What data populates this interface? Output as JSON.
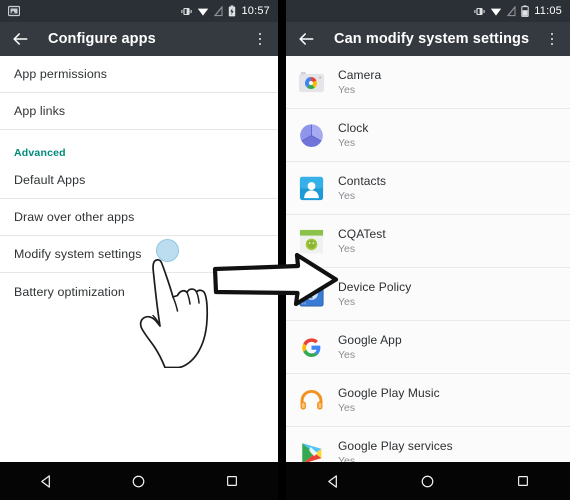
{
  "left_phone": {
    "status_bar": {
      "time": "10:57",
      "icons": [
        "screenshot-icon",
        "vibrate-icon",
        "wifi-icon",
        "signal-off-icon",
        "battery-charging-icon"
      ]
    },
    "app_bar": {
      "back_label": "back-arrow",
      "title": "Configure apps",
      "overflow_label": "more-options"
    },
    "items": [
      {
        "label": "App permissions",
        "type": "row"
      },
      {
        "label": "App links",
        "type": "row"
      },
      {
        "label": "Advanced",
        "type": "section"
      },
      {
        "label": "Default Apps",
        "type": "row"
      },
      {
        "label": "Draw over other apps",
        "type": "row"
      },
      {
        "label": "Modify system settings",
        "type": "row"
      },
      {
        "label": "Battery optimization",
        "type": "row"
      }
    ],
    "nav_bar": {
      "back": "back-triangle",
      "home": "home-circle",
      "recents": "recents-square"
    }
  },
  "right_phone": {
    "status_bar": {
      "time": "11:05",
      "icons": [
        "vibrate-icon",
        "wifi-icon",
        "signal-off-icon",
        "battery-icon"
      ]
    },
    "app_bar": {
      "back_label": "back-arrow",
      "title": "Can modify system settings",
      "overflow_label": "more-options"
    },
    "apps": [
      {
        "name": "Camera",
        "status": "Yes",
        "icon": "camera-app-icon"
      },
      {
        "name": "Clock",
        "status": "Yes",
        "icon": "clock-app-icon"
      },
      {
        "name": "Contacts",
        "status": "Yes",
        "icon": "contacts-app-icon"
      },
      {
        "name": "CQATest",
        "status": "Yes",
        "icon": "cqatest-app-icon"
      },
      {
        "name": "Device Policy",
        "status": "Yes",
        "icon": "device-policy-app-icon"
      },
      {
        "name": "Google App",
        "status": "Yes",
        "icon": "google-app-icon"
      },
      {
        "name": "Google Play Music",
        "status": "Yes",
        "icon": "play-music-app-icon"
      },
      {
        "name": "Google Play services",
        "status": "Yes",
        "icon": "play-services-app-icon"
      }
    ],
    "nav_bar": {
      "back": "back-triangle",
      "home": "home-circle",
      "recents": "recents-square"
    }
  },
  "annotations": {
    "tap_indicator": "hand-pointer-tap",
    "flow_arrow": "right-arrow-annotation"
  },
  "colors": {
    "status_bar": "#2b3036",
    "app_bar": "#343a40",
    "section_accent": "#00897b",
    "nav_bar": "#050505",
    "row_text": "#2f3234",
    "sub_text": "#8a8d90"
  }
}
